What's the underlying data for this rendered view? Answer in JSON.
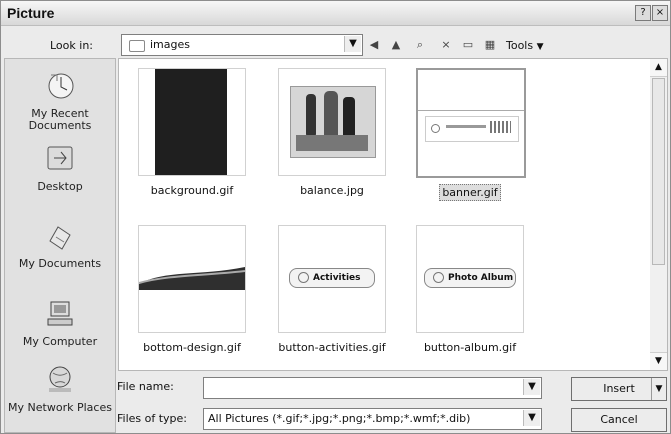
{
  "window": {
    "title": "Picture",
    "help_button": "?",
    "close_button": "×"
  },
  "toolbar": {
    "look_in_label": "Look in:",
    "look_in_value": "images",
    "tools_label": "Tools"
  },
  "places": [
    {
      "label": "My Recent Documents",
      "icon": "recent-documents-icon"
    },
    {
      "label": "Desktop",
      "icon": "desktop-icon"
    },
    {
      "label": "My Documents",
      "icon": "documents-icon"
    },
    {
      "label": "My Computer",
      "icon": "computer-icon"
    },
    {
      "label": "My Network Places",
      "icon": "network-places-icon"
    }
  ],
  "files": [
    {
      "name": "background.gif"
    },
    {
      "name": "balance.jpg"
    },
    {
      "name": "banner.gif",
      "selected": true
    },
    {
      "name": "bottom-design.gif"
    },
    {
      "name": "button-activities.gif",
      "thumb_text": "Activities"
    },
    {
      "name": "button-album.gif",
      "thumb_text": "Photo Album"
    }
  ],
  "bottom": {
    "file_name_label": "File name:",
    "file_name_value": "",
    "files_of_type_label": "Files of type:",
    "files_of_type_value": "All Pictures (*.gif;*.jpg;*.png;*.bmp;*.wmf;*.dib)",
    "insert_label": "Insert",
    "cancel_label": "Cancel"
  },
  "colors": {
    "dialog_bg": "#ebebeb",
    "selection": "#9a9a9a"
  }
}
